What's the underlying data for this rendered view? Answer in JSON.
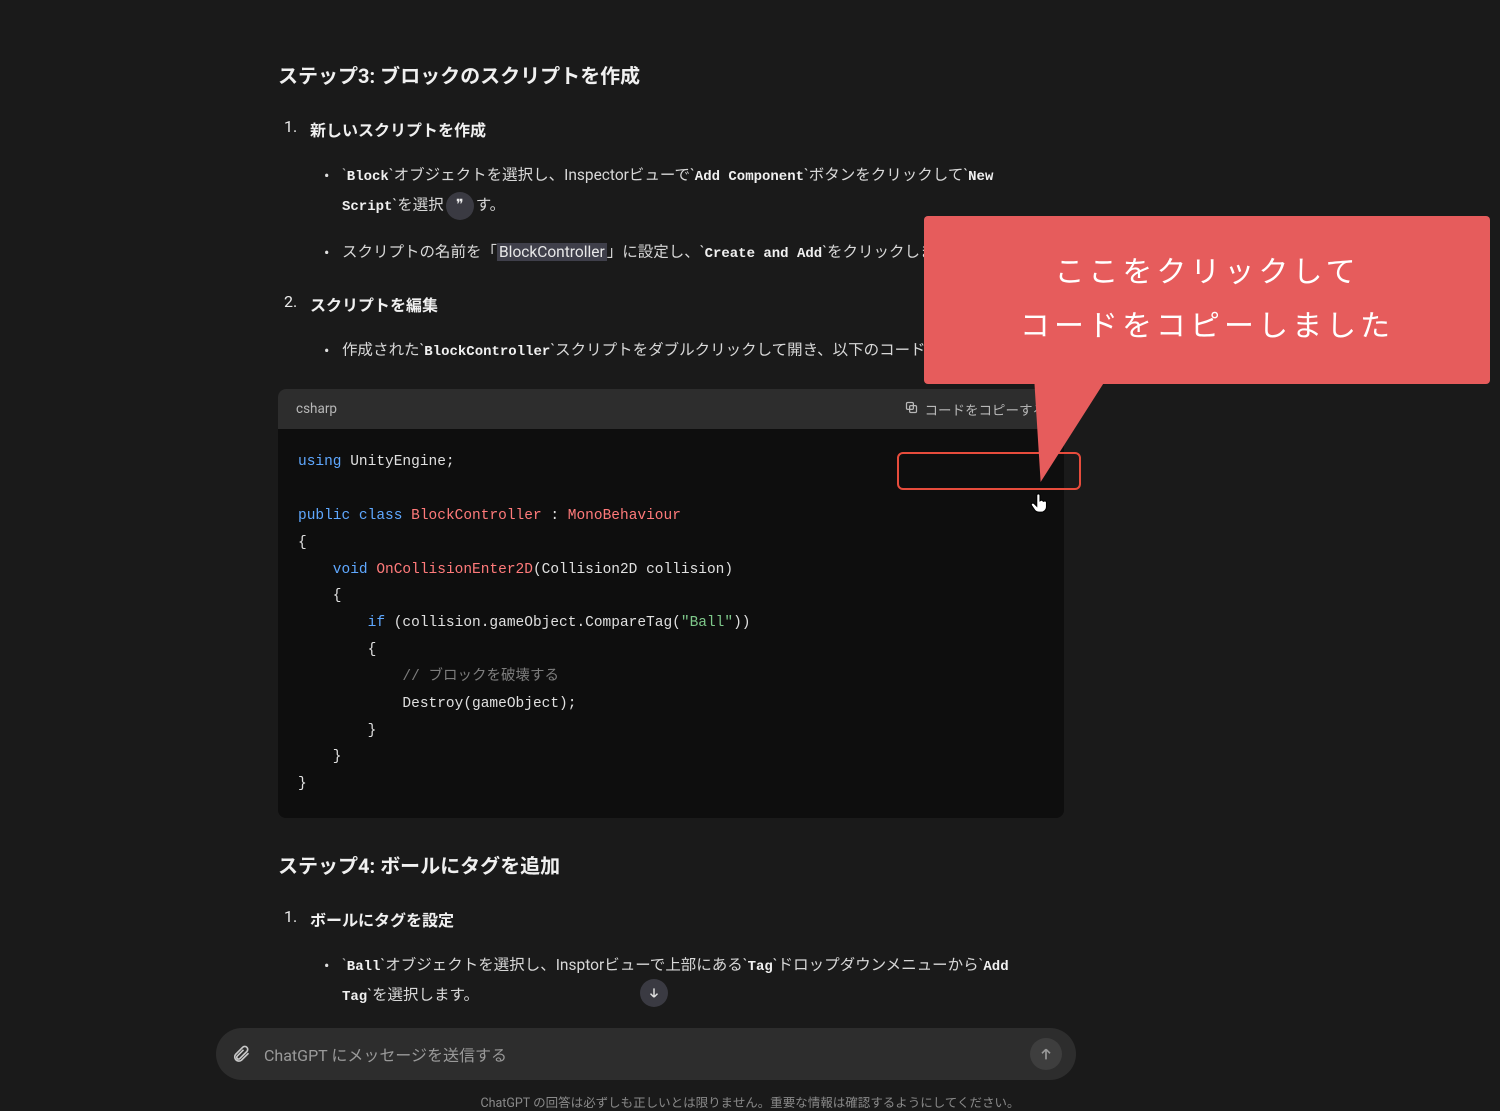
{
  "sections": {
    "step3": {
      "heading": "ステップ3: ブロックのスクリプトを作成",
      "items": [
        {
          "title": "新しいスクリプトを作成",
          "bullets": [
            {
              "pre": "`",
              "code1": "Block",
              "mid1": "`オブジェクトを選択し、Inspectorビューで`",
              "code2": "Add Component",
              "mid2": "`ボタンをクリックして`",
              "code3": "New Script",
              "tail": "`を選択",
              "after_badge": "す。"
            },
            {
              "pre": "スクリプトの名前を「",
              "highlight": "BlockController",
              "mid": "」に設定し、`",
              "code": "Create and Add",
              "tail": "`をクリックします。"
            }
          ]
        },
        {
          "title": "スクリプトを編集",
          "bullets": [
            {
              "pre": "作成された`",
              "code": "BlockController",
              "tail": "`スクリプトをダブルクリックして開き、以下のコードを追加します。"
            }
          ]
        }
      ]
    },
    "step4": {
      "heading": "ステップ4: ボールにタグを追加",
      "items": [
        {
          "title": "ボールにタグを設定",
          "bullets": [
            {
              "pre": "`",
              "code1": "Ball",
              "mid1": "`オブジェクトを選択し、Insp",
              "after_badge": "torビューで上部にある`",
              "code2": "Tag",
              "mid2": "`ドロップダウンメニューから`",
              "code3": "Add Tag",
              "tail": "`を選択します。"
            }
          ]
        }
      ]
    }
  },
  "code": {
    "language": "csharp",
    "copy_label": "コードをコピーする",
    "lines": {
      "l1_kw": "using",
      "l1_rest": " UnityEngine;",
      "l3_pub": "public",
      "l3_cls": " class ",
      "l3_name": "BlockController",
      "l3_colon": " : ",
      "l3_inh": "MonoBehaviour",
      "l5_void": "    void",
      "l5_method": " OnCollisionEnter2D",
      "l5_params": "(Collision2D collision)",
      "l7_if": "        if",
      "l7_cond_pre": " (collision.gameObject.CompareTag(",
      "l7_str": "\"Ball\"",
      "l7_cond_post": "))",
      "l9_comment": "            // ブロックを破壊する",
      "l10_destroy": "            Destroy(gameObject);"
    }
  },
  "callout": {
    "line1": "ここをクリックして",
    "line2": "コードをコピーしました"
  },
  "input": {
    "placeholder": "ChatGPT にメッセージを送信する"
  },
  "disclaimer": "ChatGPT の回答は必ずしも正しいとは限りません。重要な情報は確認するようにしてください。"
}
